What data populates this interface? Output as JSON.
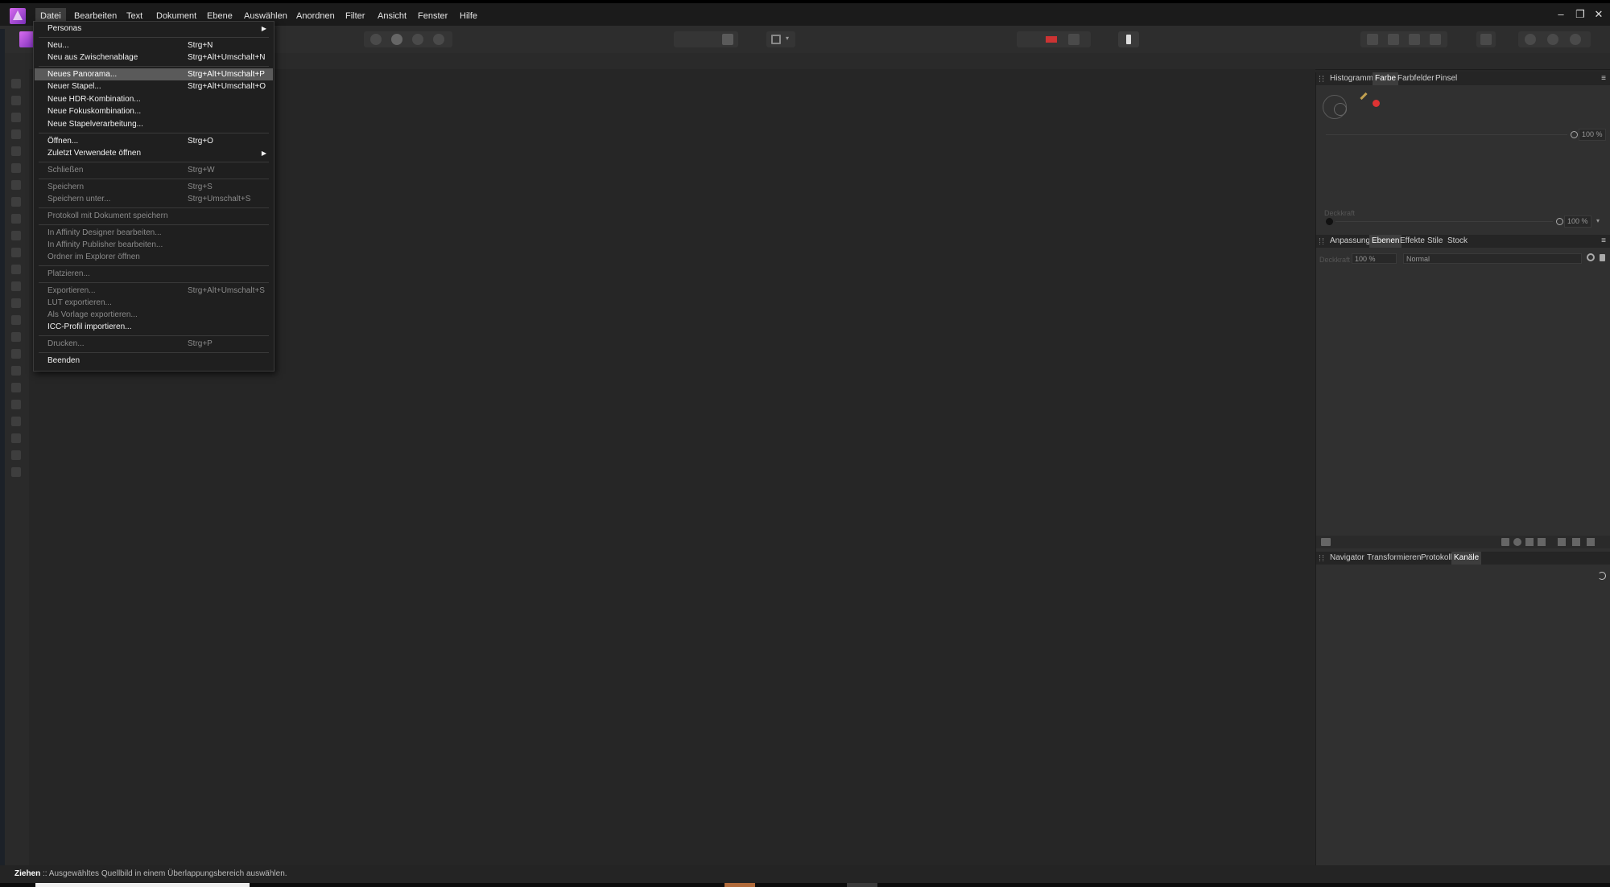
{
  "menubar": {
    "items": [
      "Datei",
      "Bearbeiten",
      "Text",
      "Dokument",
      "Ebene",
      "Auswählen",
      "Anordnen",
      "Filter",
      "Ansicht",
      "Fenster",
      "Hilfe"
    ],
    "window_controls": {
      "minimize": "–",
      "restore": "❐",
      "close": "✕"
    }
  },
  "file_menu": {
    "items": [
      {
        "label": "Personas",
        "shortcut": "",
        "submenu": true,
        "disabled": false
      },
      {
        "label": "Neu...",
        "shortcut": "Strg+N",
        "disabled": false
      },
      {
        "label": "Neu aus Zwischenablage",
        "shortcut": "Strg+Alt+Umschalt+N",
        "disabled": false
      },
      {
        "label": "Neues Panorama...",
        "shortcut": "Strg+Alt+Umschalt+P",
        "disabled": false,
        "highlighted": true
      },
      {
        "label": "Neuer Stapel...",
        "shortcut": "Strg+Alt+Umschalt+O",
        "disabled": false
      },
      {
        "label": "Neue HDR-Kombination...",
        "shortcut": "",
        "disabled": false
      },
      {
        "label": "Neue Fokuskombination...",
        "shortcut": "",
        "disabled": false
      },
      {
        "label": "Neue Stapelverarbeitung...",
        "shortcut": "",
        "disabled": false
      },
      {
        "label": "Öffnen...",
        "shortcut": "Strg+O",
        "disabled": false
      },
      {
        "label": "Zuletzt Verwendete öffnen",
        "shortcut": "",
        "submenu": true,
        "disabled": false
      },
      {
        "label": "Schließen",
        "shortcut": "Strg+W",
        "disabled": true
      },
      {
        "label": "Speichern",
        "shortcut": "Strg+S",
        "disabled": true
      },
      {
        "label": "Speichern unter...",
        "shortcut": "Strg+Umschalt+S",
        "disabled": true
      },
      {
        "label": "Protokoll mit Dokument speichern",
        "shortcut": "",
        "disabled": true
      },
      {
        "label": "In Affinity Designer bearbeiten...",
        "shortcut": "",
        "disabled": true
      },
      {
        "label": "In Affinity Publisher bearbeiten...",
        "shortcut": "",
        "disabled": true
      },
      {
        "label": "Ordner im Explorer öffnen",
        "shortcut": "",
        "disabled": true
      },
      {
        "label": "Platzieren...",
        "shortcut": "",
        "disabled": true
      },
      {
        "label": "Exportieren...",
        "shortcut": "Strg+Alt+Umschalt+S",
        "disabled": true
      },
      {
        "label": "LUT exportieren...",
        "shortcut": "",
        "disabled": true
      },
      {
        "label": "Als Vorlage exportieren...",
        "shortcut": "",
        "disabled": true
      },
      {
        "label": "ICC-Profil importieren...",
        "shortcut": "",
        "disabled": false
      },
      {
        "label": "Drucken...",
        "shortcut": "Strg+P",
        "disabled": true
      },
      {
        "label": "Beenden",
        "shortcut": "",
        "disabled": false
      }
    ]
  },
  "color_panel": {
    "tabs": [
      "Histogramm",
      "Farbe",
      "Farbfelder",
      "Pinsel"
    ],
    "active_tab": "Farbe",
    "opacity_value": "100 %",
    "noise_label": "Deckkraft",
    "noise_value": "100 %"
  },
  "layers_panel": {
    "tabs": [
      "Anpassung",
      "Ebenen",
      "Effekte",
      "Stile",
      "Stock"
    ],
    "active_tab": "Ebenen",
    "opacity_label": "Deckkraft",
    "opacity_value": "100 %",
    "blend_mode": "Normal"
  },
  "navigator_panel": {
    "tabs": [
      "Navigator",
      "Transformieren",
      "Protokoll",
      "Kanäle"
    ],
    "active_tab": "Kanäle"
  },
  "statusbar": {
    "tool_name": "Ziehen",
    "message": " :: Ausgewähltes Quellbild in einem Überlappungsbereich auswählen."
  },
  "colors": {
    "accent_logo": "#b24fe0",
    "menu_highlight": "#5a5a5a",
    "swatch_red": "#d33"
  }
}
